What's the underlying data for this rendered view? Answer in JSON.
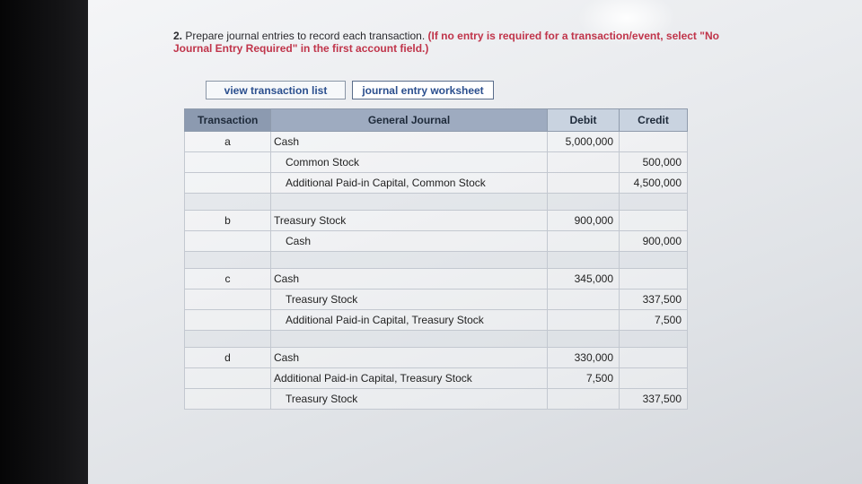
{
  "question": {
    "number": "2.",
    "text": "Prepare journal entries to record each transaction.",
    "instruction": "(If no entry is required for a transaction/event, select \"No Journal Entry Required\" in the first account field.)"
  },
  "tabs": {
    "view_transaction_list": "view transaction list",
    "journal_entry_worksheet": "journal entry worksheet"
  },
  "table": {
    "headers": {
      "transaction": "Transaction",
      "general_journal": "General Journal",
      "debit": "Debit",
      "credit": "Credit"
    },
    "rows": [
      {
        "transaction": "a",
        "account": "Cash",
        "debit": "5,000,000",
        "credit": ""
      },
      {
        "transaction": "",
        "account": "Common Stock",
        "debit": "",
        "credit": "500,000"
      },
      {
        "transaction": "",
        "account": "Additional Paid-in Capital, Common Stock",
        "debit": "",
        "credit": "4,500,000"
      },
      {
        "transaction": "b",
        "account": "Treasury Stock",
        "debit": "900,000",
        "credit": ""
      },
      {
        "transaction": "",
        "account": "Cash",
        "debit": "",
        "credit": "900,000"
      },
      {
        "transaction": "c",
        "account": "Cash",
        "debit": "345,000",
        "credit": ""
      },
      {
        "transaction": "",
        "account": "Treasury Stock",
        "debit": "",
        "credit": "337,500"
      },
      {
        "transaction": "",
        "account": "Additional Paid-in Capital, Treasury Stock",
        "debit": "",
        "credit": "7,500"
      },
      {
        "transaction": "d",
        "account": "Cash",
        "debit": "330,000",
        "credit": ""
      },
      {
        "transaction": "",
        "account": "Additional Paid-in Capital, Treasury Stock",
        "debit": "7,500",
        "credit": ""
      },
      {
        "transaction": "",
        "account": "Treasury Stock",
        "debit": "",
        "credit": "337,500"
      }
    ]
  }
}
